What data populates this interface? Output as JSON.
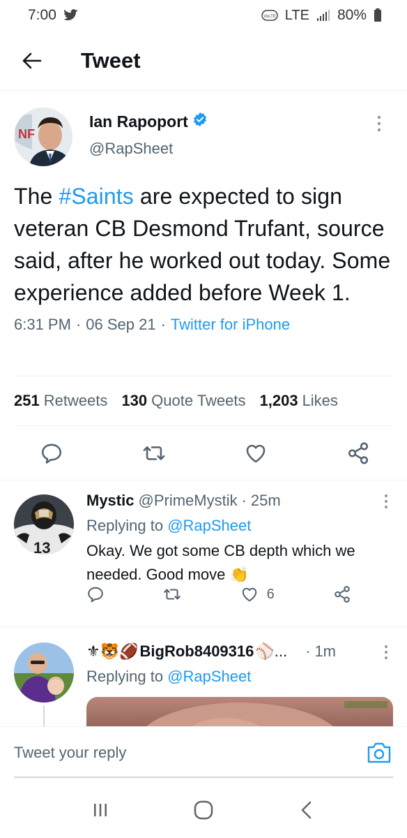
{
  "status_bar": {
    "time": "7:00",
    "network": "LTE",
    "volte": "VoLTE",
    "battery": "80%",
    "notification_icon": "twitter-bird-icon"
  },
  "header": {
    "title": "Tweet",
    "back_icon": "arrow-left-icon"
  },
  "tweet": {
    "author_name": "Ian Rapoport",
    "author_handle": "@RapSheet",
    "verified": true,
    "text_before": "The ",
    "hashtag": "#Saints",
    "text_after": " are expected to sign veteran CB Desmond Trufant, source said, after he worked out today. Some experience added before Week 1.",
    "time": "6:31 PM",
    "date": "06 Sep 21",
    "source": "Twitter for iPhone",
    "separator": "·"
  },
  "stats": {
    "retweets_count": "251",
    "retweets_label": "Retweets",
    "quotes_count": "130",
    "quotes_label": "Quote Tweets",
    "likes_count": "1,203",
    "likes_label": "Likes"
  },
  "replies": [
    {
      "name": "Mystic",
      "handle": "@PrimeMystik",
      "time": "25m",
      "replying_to_prefix": "Replying to ",
      "replying_to": "@RapSheet",
      "text": "Okay. We got some CB depth which we needed. Good move",
      "emoji": "👏",
      "like_count": "6"
    },
    {
      "name_prefix_emojis": "⚜🐯🏈",
      "name": "BigRob8409316",
      "name_suffix": "⚾...",
      "time": "1m",
      "replying_to_prefix": "Replying to ",
      "replying_to": "@RapSheet"
    }
  ],
  "compose": {
    "placeholder": "Tweet your reply"
  },
  "colors": {
    "accent": "#1d9bf0",
    "text": "#0f1419",
    "muted": "#536471"
  }
}
